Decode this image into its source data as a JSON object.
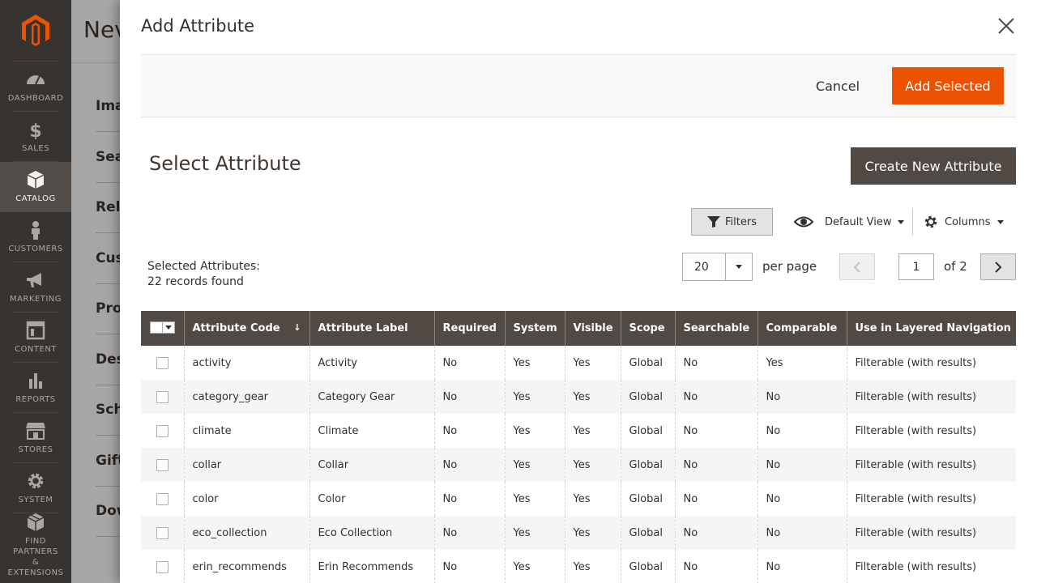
{
  "nav": {
    "items": [
      {
        "label": "DASHBOARD",
        "icon": "dashboard-icon"
      },
      {
        "label": "SALES",
        "icon": "dollar-icon"
      },
      {
        "label": "CATALOG",
        "icon": "catalog-box-icon",
        "active": true
      },
      {
        "label": "CUSTOMERS",
        "icon": "customer-icon"
      },
      {
        "label": "MARKETING",
        "icon": "megaphone-icon"
      },
      {
        "label": "CONTENT",
        "icon": "content-layout-icon"
      },
      {
        "label": "REPORTS",
        "icon": "bar-chart-icon"
      },
      {
        "label": "STORES",
        "icon": "store-icon"
      },
      {
        "label": "SYSTEM",
        "icon": "gear-icon"
      }
    ],
    "partners": {
      "line1": "FIND",
      "line2": "PARTNERS &",
      "line3": "EXTENSIONS",
      "icon": "partners-icon"
    }
  },
  "background": {
    "title": "Nev",
    "sections": [
      "Ima",
      "Sea",
      "Rela",
      "Cus",
      "Prod",
      "Des",
      "Sch",
      "Gift",
      "Dow"
    ]
  },
  "modal": {
    "title": "Add Attribute",
    "cancel_label": "Cancel",
    "add_label": "Add Selected",
    "select_title": "Select Attribute",
    "create_label": "Create New Attribute",
    "filters_label": "Filters",
    "view_label": "Default View",
    "columns_label": "Columns",
    "selected_label": "Selected Attributes:",
    "records_found": "22 records found",
    "per_page_value": "20",
    "per_page_label": "per page",
    "current_page": "1",
    "page_of": "of 2"
  },
  "colors": {
    "accent": "#eb5202",
    "header_bg": "#514943",
    "nav_bg": "#373330"
  },
  "table": {
    "columns": [
      "Attribute Code",
      "Attribute Label",
      "Required",
      "System",
      "Visible",
      "Scope",
      "Searchable",
      "Comparable",
      "Use in Layered Navigation"
    ],
    "rows": [
      [
        "activity",
        "Activity",
        "No",
        "Yes",
        "Yes",
        "Global",
        "No",
        "Yes",
        "Filterable (with results)"
      ],
      [
        "category_gear",
        "Category Gear",
        "No",
        "Yes",
        "Yes",
        "Global",
        "No",
        "No",
        "Filterable (with results)"
      ],
      [
        "climate",
        "Climate",
        "No",
        "Yes",
        "Yes",
        "Global",
        "No",
        "No",
        "Filterable (with results)"
      ],
      [
        "collar",
        "Collar",
        "No",
        "Yes",
        "Yes",
        "Global",
        "No",
        "No",
        "Filterable (with results)"
      ],
      [
        "color",
        "Color",
        "No",
        "Yes",
        "Yes",
        "Global",
        "No",
        "No",
        "Filterable (with results)"
      ],
      [
        "eco_collection",
        "Eco Collection",
        "No",
        "Yes",
        "Yes",
        "Global",
        "No",
        "No",
        "Filterable (with results)"
      ],
      [
        "erin_recommends",
        "Erin Recommends",
        "No",
        "Yes",
        "Yes",
        "Global",
        "No",
        "No",
        "Filterable (with results)"
      ]
    ]
  }
}
